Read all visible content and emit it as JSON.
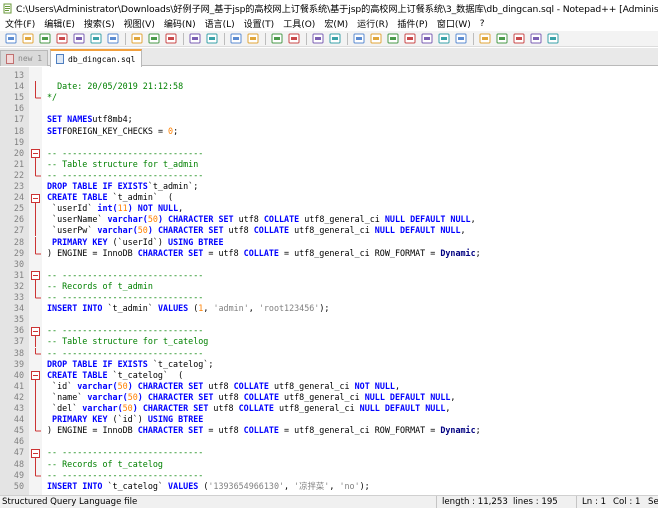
{
  "window": {
    "title": "C:\\Users\\Administrator\\Downloads\\好例子网_基于jsp的高校网上订餐系统\\基于jsp的高校网上订餐系统\\3_数据库\\db_dingcan.sql - Notepad++ [Administrator]"
  },
  "menu": [
    "文件(F)",
    "编辑(E)",
    "搜索(S)",
    "视图(V)",
    "编码(N)",
    "语言(L)",
    "设置(T)",
    "工具(O)",
    "宏(M)",
    "运行(R)",
    "插件(P)",
    "窗口(W)",
    "?"
  ],
  "tabs": [
    "new 1",
    "db_dingcan.sql"
  ],
  "editor": {
    "lines": [
      {
        "n": "13",
        "fold": "none",
        "t": []
      },
      {
        "n": "14",
        "fold": "line",
        "t": [
          [
            "cm",
            "  Date: 20/05/2019 21:12:58"
          ]
        ]
      },
      {
        "n": "15",
        "fold": "end",
        "t": [
          [
            "cm",
            "*/"
          ]
        ]
      },
      {
        "n": "16",
        "fold": "none",
        "t": []
      },
      {
        "n": "17",
        "fold": "none",
        "t": [
          [
            "kw",
            "SET NAMES"
          ],
          [
            "",
            "utf8mb4;"
          ]
        ]
      },
      {
        "n": "18",
        "fold": "none",
        "t": [
          [
            "kw",
            "SET"
          ],
          [
            "",
            "FOREIGN_KEY_CHECKS = "
          ],
          [
            "num",
            "0"
          ],
          [
            "",
            ";"
          ]
        ]
      },
      {
        "n": "19",
        "fold": "none",
        "t": []
      },
      {
        "n": "20",
        "fold": "start",
        "t": [
          [
            "cm",
            "-- ----------------------------"
          ]
        ]
      },
      {
        "n": "21",
        "fold": "line",
        "t": [
          [
            "cm",
            "-- Table structure for t_admin"
          ]
        ]
      },
      {
        "n": "22",
        "fold": "end",
        "t": [
          [
            "cm",
            "-- ----------------------------"
          ]
        ]
      },
      {
        "n": "23",
        "fold": "none",
        "t": [
          [
            "kw",
            "DROP TABLE IF EXISTS"
          ],
          [
            "",
            "`t_admin`;"
          ]
        ]
      },
      {
        "n": "24",
        "fold": "start",
        "t": [
          [
            "kw",
            "CREATE TABLE"
          ],
          [
            "",
            " `t_admin`  ("
          ]
        ]
      },
      {
        "n": "25",
        "fold": "line",
        "t": [
          [
            "",
            " `userId` "
          ],
          [
            "kw",
            "int("
          ],
          [
            "num",
            "11"
          ],
          [
            "kw",
            ") NOT NULL"
          ],
          [
            "",
            ","
          ]
        ]
      },
      {
        "n": "26",
        "fold": "line",
        "t": [
          [
            "",
            " `userName` "
          ],
          [
            "kw",
            "varchar("
          ],
          [
            "num",
            "50"
          ],
          [
            "kw",
            ") CHARACTER SET"
          ],
          [
            "",
            " utf8 "
          ],
          [
            "kw",
            "COLLATE"
          ],
          [
            "",
            " utf8_general_ci "
          ],
          [
            "kw",
            "NULL DEFAULT NULL"
          ],
          [
            "",
            ","
          ]
        ]
      },
      {
        "n": "27",
        "fold": "line",
        "t": [
          [
            "",
            " `userPw` "
          ],
          [
            "kw",
            "varchar("
          ],
          [
            "num",
            "50"
          ],
          [
            "kw",
            ") CHARACTER SET"
          ],
          [
            "",
            " utf8 "
          ],
          [
            "kw",
            "COLLATE"
          ],
          [
            "",
            " utf8_general_ci "
          ],
          [
            "kw",
            "NULL DEFAULT NULL"
          ],
          [
            "",
            ","
          ]
        ]
      },
      {
        "n": "28",
        "fold": "line",
        "t": [
          [
            "kw",
            " PRIMARY KEY"
          ],
          [
            "",
            " (`userId`) "
          ],
          [
            "kw",
            "USING BTREE"
          ]
        ]
      },
      {
        "n": "29",
        "fold": "end",
        "t": [
          [
            "",
            ") ENGINE = InnoDB "
          ],
          [
            "kw",
            "CHARACTER SET"
          ],
          [
            "",
            " = utf8 "
          ],
          [
            "kw",
            "COLLATE"
          ],
          [
            "",
            " = utf8_general_ci ROW_FORMAT = "
          ],
          [
            "op",
            "Dynamic"
          ],
          [
            "",
            ";"
          ]
        ]
      },
      {
        "n": "30",
        "fold": "none",
        "t": []
      },
      {
        "n": "31",
        "fold": "start",
        "t": [
          [
            "cm",
            "-- ----------------------------"
          ]
        ]
      },
      {
        "n": "32",
        "fold": "line",
        "t": [
          [
            "cm",
            "-- Records of t_admin"
          ]
        ]
      },
      {
        "n": "33",
        "fold": "end",
        "t": [
          [
            "cm",
            "-- ----------------------------"
          ]
        ]
      },
      {
        "n": "34",
        "fold": "none",
        "t": [
          [
            "kw",
            "INSERT INTO"
          ],
          [
            "",
            " `t_admin` "
          ],
          [
            "kw",
            "VALUES"
          ],
          [
            "",
            " ("
          ],
          [
            "num",
            "1"
          ],
          [
            "",
            ", "
          ],
          [
            "str",
            "'admin'"
          ],
          [
            "",
            ", "
          ],
          [
            "str",
            "'root123456'"
          ],
          [
            "",
            ");"
          ]
        ]
      },
      {
        "n": "35",
        "fold": "none",
        "t": []
      },
      {
        "n": "36",
        "fold": "start",
        "t": [
          [
            "cm",
            "-- ----------------------------"
          ]
        ]
      },
      {
        "n": "37",
        "fold": "line",
        "t": [
          [
            "cm",
            "-- Table structure for t_catelog"
          ]
        ]
      },
      {
        "n": "38",
        "fold": "end",
        "t": [
          [
            "cm",
            "-- ----------------------------"
          ]
        ]
      },
      {
        "n": "39",
        "fold": "none",
        "t": [
          [
            "kw",
            "DROP TABLE IF EXISTS"
          ],
          [
            "",
            " `t_catelog`;"
          ]
        ]
      },
      {
        "n": "40",
        "fold": "start",
        "t": [
          [
            "kw",
            "CREATE TABLE"
          ],
          [
            "",
            " `t_catelog`  ("
          ]
        ]
      },
      {
        "n": "41",
        "fold": "line",
        "t": [
          [
            "",
            " `id` "
          ],
          [
            "kw",
            "varchar("
          ],
          [
            "num",
            "50"
          ],
          [
            "kw",
            ") CHARACTER SET"
          ],
          [
            "",
            " utf8 "
          ],
          [
            "kw",
            "COLLATE"
          ],
          [
            "",
            " utf8_general_ci "
          ],
          [
            "kw",
            "NOT NULL"
          ],
          [
            "",
            ","
          ]
        ]
      },
      {
        "n": "42",
        "fold": "line",
        "t": [
          [
            "",
            " `name` "
          ],
          [
            "kw",
            "varchar("
          ],
          [
            "num",
            "50"
          ],
          [
            "kw",
            ") CHARACTER SET"
          ],
          [
            "",
            " utf8 "
          ],
          [
            "kw",
            "COLLATE"
          ],
          [
            "",
            " utf8_general_ci "
          ],
          [
            "kw",
            "NULL DEFAULT NULL"
          ],
          [
            "",
            ","
          ]
        ]
      },
      {
        "n": "43",
        "fold": "line",
        "t": [
          [
            "",
            " `del` "
          ],
          [
            "kw",
            "varchar("
          ],
          [
            "num",
            "50"
          ],
          [
            "kw",
            ") CHARACTER SET"
          ],
          [
            "",
            " utf8 "
          ],
          [
            "kw",
            "COLLATE"
          ],
          [
            "",
            " utf8_general_ci "
          ],
          [
            "kw",
            "NULL DEFAULT NULL"
          ],
          [
            "",
            ","
          ]
        ]
      },
      {
        "n": "44",
        "fold": "line",
        "t": [
          [
            "kw",
            " PRIMARY KEY"
          ],
          [
            "",
            " (`id`) "
          ],
          [
            "kw",
            "USING BTREE"
          ]
        ]
      },
      {
        "n": "45",
        "fold": "end",
        "t": [
          [
            "",
            ") ENGINE = InnoDB "
          ],
          [
            "kw",
            "CHARACTER SET"
          ],
          [
            "",
            " = utf8 "
          ],
          [
            "kw",
            "COLLATE"
          ],
          [
            "",
            " = utf8_general_ci ROW_FORMAT = "
          ],
          [
            "op",
            "Dynamic"
          ],
          [
            "",
            ";"
          ]
        ]
      },
      {
        "n": "46",
        "fold": "none",
        "t": []
      },
      {
        "n": "47",
        "fold": "start",
        "t": [
          [
            "cm",
            "-- ----------------------------"
          ]
        ]
      },
      {
        "n": "48",
        "fold": "line",
        "t": [
          [
            "cm",
            "-- Records of t_catelog"
          ]
        ]
      },
      {
        "n": "49",
        "fold": "end",
        "t": [
          [
            "cm",
            "-- ----------------------------"
          ]
        ]
      },
      {
        "n": "50",
        "fold": "none",
        "t": [
          [
            "kw",
            "INSERT INTO"
          ],
          [
            "",
            " `t_catelog` "
          ],
          [
            "kw",
            "VALUES"
          ],
          [
            "",
            " ("
          ],
          [
            "str",
            "'1393654966130'"
          ],
          [
            "",
            ", "
          ],
          [
            "str",
            "'凉拌菜'"
          ],
          [
            "",
            ", "
          ],
          [
            "str",
            "'no'"
          ],
          [
            "",
            ");"
          ]
        ]
      }
    ]
  },
  "status": {
    "lang": "Structured Query Language file",
    "length": "length : 11,253",
    "lines": "lines : 195",
    "ln": "Ln : 1",
    "col": "Col : 1",
    "sel": "Se"
  },
  "colors": {
    "keyword": "#0000ff",
    "comment": "#008000",
    "number": "#ff8000",
    "string": "#808080",
    "active_tab": "#f2a03d"
  },
  "toolbar_icons": [
    "new-file-icon",
    "open-file-icon",
    "save-icon",
    "save-all-icon",
    "close-icon",
    "close-all-icon",
    "print-icon",
    "cut-icon",
    "copy-icon",
    "paste-icon",
    "undo-icon",
    "redo-icon",
    "find-icon",
    "replace-icon",
    "zoom-in-icon",
    "zoom-out-icon",
    "sync-v-icon",
    "sync-h-icon",
    "word-wrap-icon",
    "show-all-chars-icon",
    "indent-guide-icon",
    "doc-map-icon",
    "function-list-icon",
    "folder-workspace-icon",
    "monitor-icon",
    "record-macro-icon",
    "stop-record-icon",
    "play-macro-icon",
    "run-macro-icon",
    "save-macro-icon"
  ]
}
